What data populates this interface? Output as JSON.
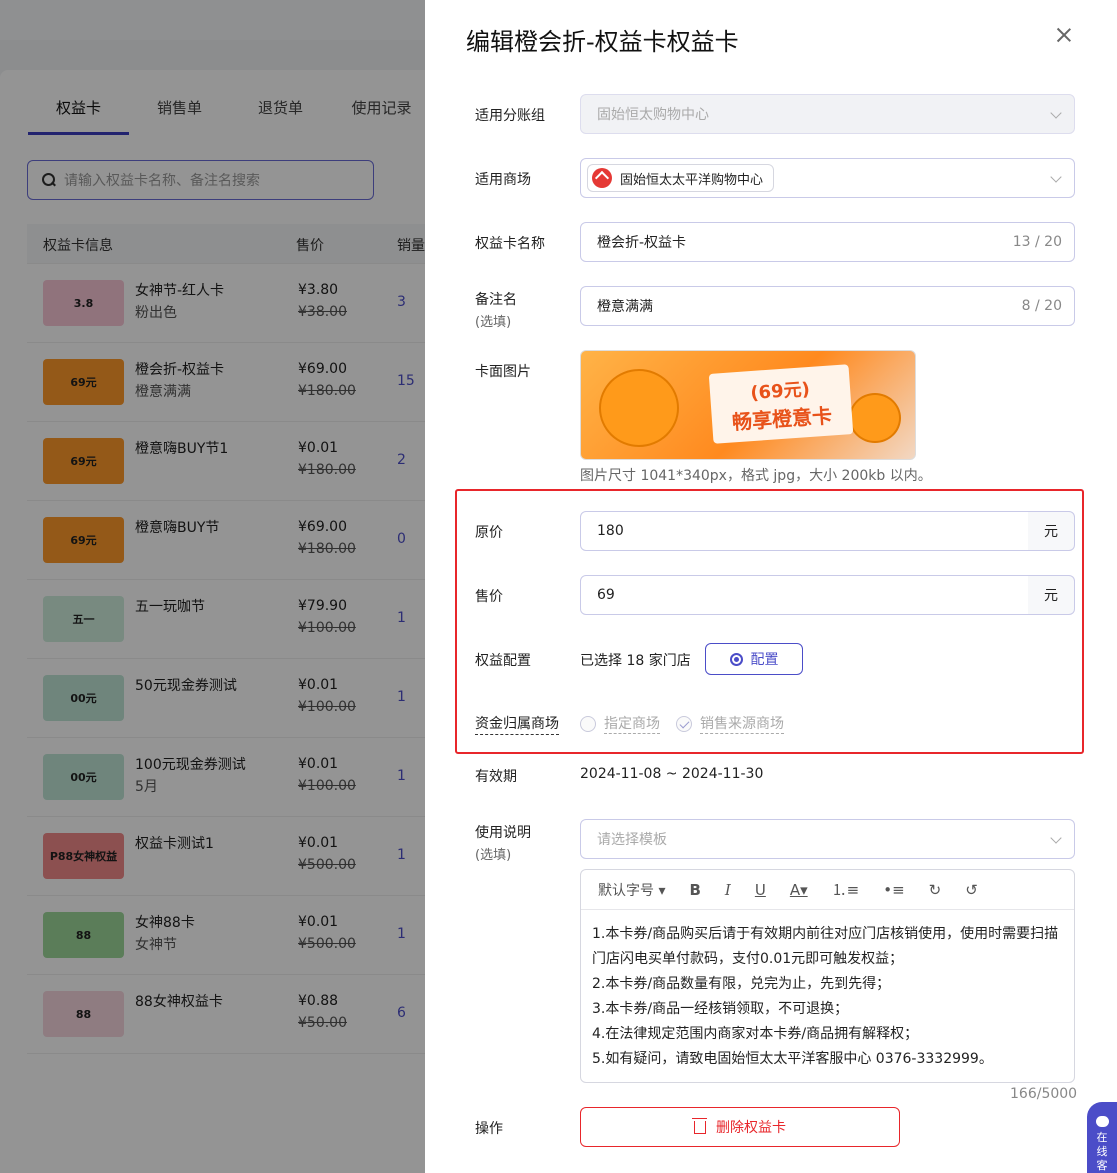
{
  "background": {
    "tabs": [
      "权益卡",
      "销售单",
      "退货单",
      "使用记录"
    ],
    "search_placeholder": "请输入权益卡名称、备注名搜索",
    "columns": [
      "权益卡信息",
      "售价",
      "销量"
    ],
    "rows": [
      {
        "name": "女神节-红人卡",
        "sub": "粉出色",
        "price": "¥3.80",
        "orig": "¥38.00",
        "qty": "3",
        "thumb_text": "3.8",
        "thumb_color": "#f9c6d6"
      },
      {
        "name": "橙会折-权益卡",
        "sub": "橙意满满",
        "price": "¥69.00",
        "orig": "¥180.00",
        "qty": "15",
        "thumb_text": "69元",
        "thumb_color": "#ff9a2a"
      },
      {
        "name": "橙意嗨BUY节1",
        "sub": "",
        "price": "¥0.01",
        "orig": "¥180.00",
        "qty": "2",
        "thumb_text": "69元",
        "thumb_color": "#ff9a2a"
      },
      {
        "name": "橙意嗨BUY节",
        "sub": "",
        "price": "¥69.00",
        "orig": "¥180.00",
        "qty": "0",
        "thumb_text": "69元",
        "thumb_color": "#ff9a2a"
      },
      {
        "name": "五一玩咖节",
        "sub": "",
        "price": "¥79.90",
        "orig": "¥100.00",
        "qty": "1",
        "thumb_text": "五一",
        "thumb_color": "#cfeedd"
      },
      {
        "name": "50元现金券测试",
        "sub": "",
        "price": "¥0.01",
        "orig": "¥100.00",
        "qty": "1",
        "thumb_text": "00元",
        "thumb_color": "#bfe6d6"
      },
      {
        "name": "100元现金券测试",
        "sub": "5月",
        "price": "¥0.01",
        "orig": "¥100.00",
        "qty": "1",
        "thumb_text": "00元",
        "thumb_color": "#bfe6d6"
      },
      {
        "name": "权益卡测试1",
        "sub": "",
        "price": "¥0.01",
        "orig": "¥500.00",
        "qty": "1",
        "thumb_text": "P88女神权益",
        "thumb_color": "#f28b8b"
      },
      {
        "name": "女神88卡",
        "sub": "女神节",
        "price": "¥0.01",
        "orig": "¥500.00",
        "qty": "1",
        "thumb_text": "88",
        "thumb_color": "#9ed89a"
      },
      {
        "name": "88女神权益卡",
        "sub": "",
        "price": "¥0.88",
        "orig": "¥50.00",
        "qty": "6",
        "thumb_text": "88",
        "thumb_color": "#f6d6de"
      }
    ]
  },
  "drawer": {
    "title": "编辑橙会折-权益卡权益卡",
    "fields": {
      "group_label": "适用分账组",
      "group_value": "固始恒太购物中心",
      "mall_label": "适用商场",
      "mall_tag": "固始恒太太平洋购物中心",
      "name_label": "权益卡名称",
      "name_value": "橙会折-权益卡",
      "name_count": "13 / 20",
      "remark_label": "备注名",
      "remark_opt": "(选填)",
      "remark_value": "橙意满满",
      "remark_count": "8 / 20",
      "image_label": "卡面图片",
      "image_text_1": "(69元)",
      "image_text_2": "畅享橙意卡",
      "image_hint": "图片尺寸 1041*340px，格式 jpg，大小 200kb 以内。",
      "orig_price_label": "原价",
      "orig_price_value": "180",
      "unit": "元",
      "sale_price_label": "售价",
      "sale_price_value": "69",
      "rights_label": "权益配置",
      "rights_text": "已选择  18  家门店",
      "rights_button": "配置",
      "fund_label": "资金归属商场",
      "fund_option_1": "指定商场",
      "fund_option_2": "销售来源商场",
      "validity_label": "有效期",
      "validity_value": "2024-11-08 ~ 2024-11-30",
      "usage_label": "使用说明",
      "usage_opt": "(选填)",
      "template_placeholder": "请选择模板",
      "font_size": "默认字号",
      "editor_lines": [
        "1.本卡券/商品购买后请于有效期内前往对应门店核销使用，使用时需要扫描门店闪电买单付款码，支付0.01元即可触发权益；",
        "2.本卡券/商品数量有限，兑完为止，先到先得；",
        "3.本卡券/商品一经核销领取，不可退换；",
        "4.在法律规定范围内商家对本卡券/商品拥有解释权；",
        "5.如有疑问，请致电固始恒太太平洋客服中心 0376-3332999。"
      ],
      "char_count": "166/5000",
      "action_label": "操作",
      "delete_button": "删除权益卡"
    }
  },
  "chat_widget": {
    "chars": [
      "在",
      "线",
      "客"
    ]
  },
  "colors": {
    "primary": "#4b4dc8",
    "danger": "#e8262b",
    "accent_orange": "#ff8a1f"
  }
}
